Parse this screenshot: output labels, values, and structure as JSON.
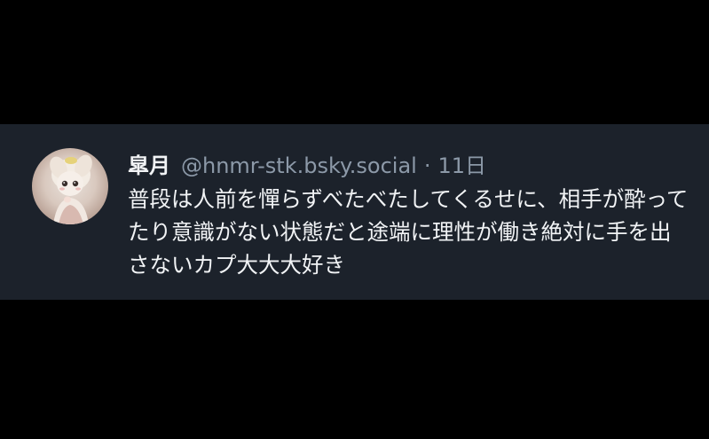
{
  "post": {
    "author": {
      "display_name": "皐月",
      "handle": "@hnmr-stk.bsky.social"
    },
    "separator": "·",
    "timestamp": "11日",
    "text": "普段は人前を憚らずべたべたしてくるせに、相手が酔ってたり意識がない状態だと途端に理性が働き絶対に手を出さないカプ大大大好き"
  },
  "colors": {
    "page_background": "#000000",
    "card_background": "#1c222b",
    "primary_text": "#f1f3f5",
    "secondary_text": "#8c99a8"
  },
  "icons": {
    "avatar": "doll-avatar"
  }
}
